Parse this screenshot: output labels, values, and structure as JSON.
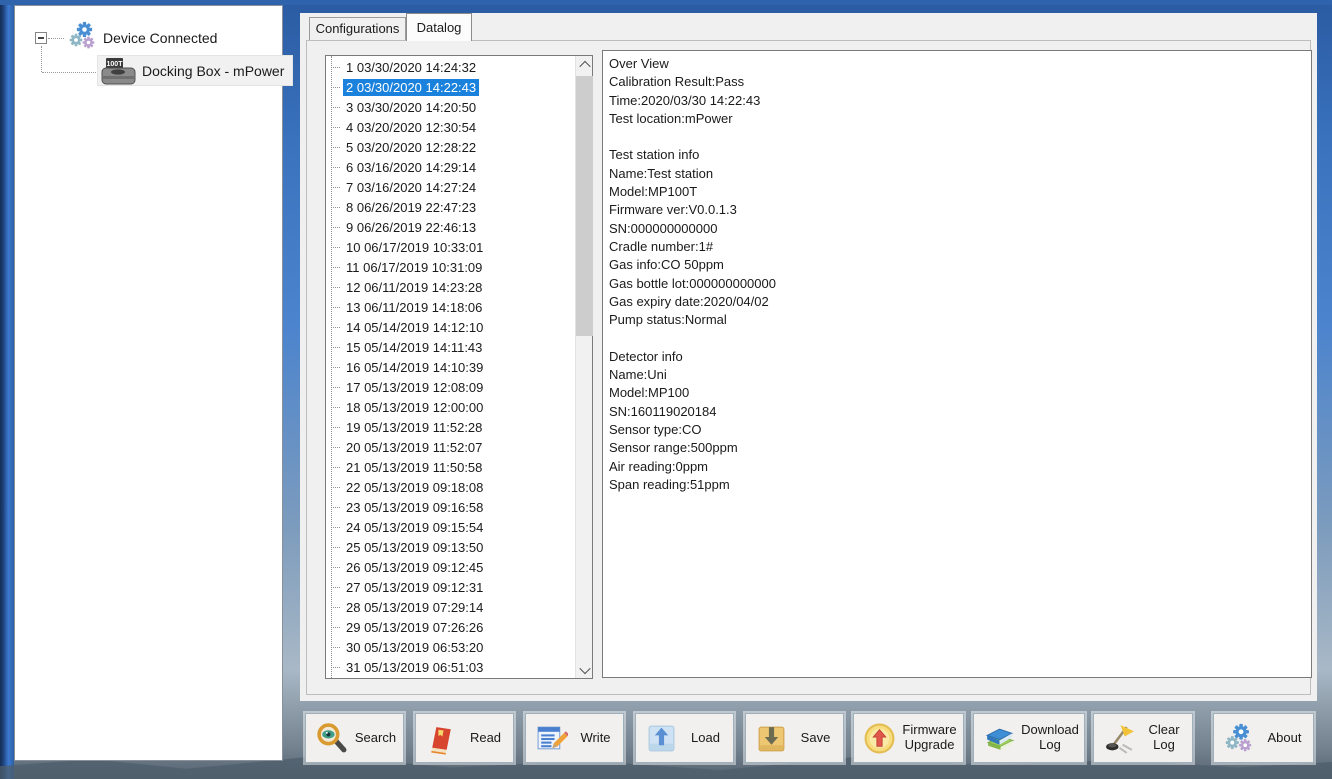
{
  "colors": {
    "selection": "#1a82dc",
    "panel": "#f0f0f0",
    "desktop_blue": "#3a72bd"
  },
  "tree": {
    "root_label": "Device Connected",
    "child_label": "Docking Box - mPower",
    "child_icon_text": "100T"
  },
  "tabs": [
    {
      "label": "Configurations",
      "active": false
    },
    {
      "label": "Datalog",
      "active": true
    }
  ],
  "datalog": {
    "selected_index": 1,
    "entries": [
      "1 03/30/2020 14:24:32",
      "2 03/30/2020 14:22:43",
      "3 03/30/2020 14:20:50",
      "4 03/20/2020 12:30:54",
      "5 03/20/2020 12:28:22",
      "6 03/16/2020 14:29:14",
      "7 03/16/2020 14:27:24",
      "8 06/26/2019 22:47:23",
      "9 06/26/2019 22:46:13",
      "10 06/17/2019 10:33:01",
      "11 06/17/2019 10:31:09",
      "12 06/11/2019 14:23:28",
      "13 06/11/2019 14:18:06",
      "14 05/14/2019 14:12:10",
      "15 05/14/2019 14:11:43",
      "16 05/14/2019 14:10:39",
      "17 05/13/2019 12:08:09",
      "18 05/13/2019 12:00:00",
      "19 05/13/2019 11:52:28",
      "20 05/13/2019 11:52:07",
      "21 05/13/2019 11:50:58",
      "22 05/13/2019 09:18:08",
      "23 05/13/2019 09:16:58",
      "24 05/13/2019 09:15:54",
      "25 05/13/2019 09:13:50",
      "26 05/13/2019 09:12:45",
      "27 05/13/2019 09:12:31",
      "28 05/13/2019 07:29:14",
      "29 05/13/2019 07:26:26",
      "30 05/13/2019 06:53:20",
      "31 05/13/2019 06:51:03"
    ]
  },
  "details": {
    "lines": [
      "Over View",
      "Calibration Result:Pass",
      "Time:2020/03/30 14:22:43",
      "Test location:mPower",
      "",
      "Test station info",
      "Name:Test station",
      "Model:MP100T",
      "Firmware ver:V0.0.1.3",
      "SN:000000000000",
      "Cradle number:1#",
      "Gas info:CO 50ppm",
      "Gas bottle lot:000000000000",
      "Gas expiry date:2020/04/02",
      "Pump status:Normal",
      "",
      "Detector info",
      "Name:Uni",
      "Model:MP100",
      "SN:160119020184",
      "Sensor type:CO",
      "Sensor range:500ppm",
      "Air reading:0ppm",
      "Span reading:51ppm"
    ]
  },
  "toolbar": {
    "buttons": [
      {
        "name": "search-button",
        "label": "Search",
        "icon": "search-icon"
      },
      {
        "name": "read-button",
        "label": "Read",
        "icon": "read-icon"
      },
      {
        "name": "write-button",
        "label": "Write",
        "icon": "write-icon"
      },
      {
        "name": "load-button",
        "label": "Load",
        "icon": "load-icon"
      },
      {
        "name": "save-button",
        "label": "Save",
        "icon": "save-icon"
      },
      {
        "name": "firmware-upgrade-button",
        "label": "Firmware\nUpgrade",
        "icon": "firmware-upgrade-icon"
      },
      {
        "name": "download-log-button",
        "label": "Download\nLog",
        "icon": "download-log-icon"
      },
      {
        "name": "clear-log-button",
        "label": "Clear\nLog",
        "icon": "clear-log-icon"
      },
      {
        "name": "about-button",
        "label": "About",
        "icon": "about-icon"
      }
    ]
  }
}
